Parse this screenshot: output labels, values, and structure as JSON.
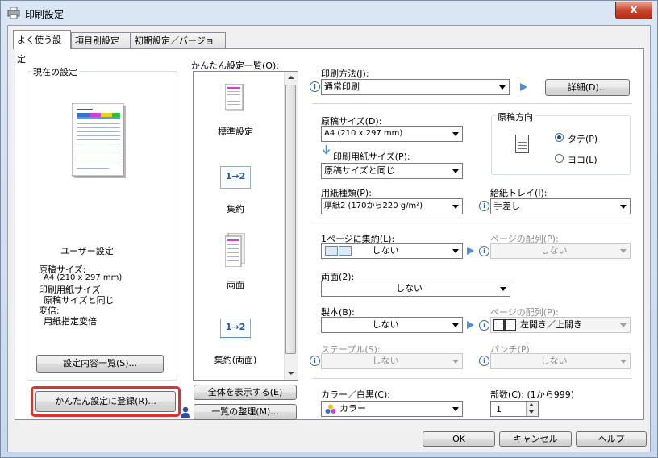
{
  "window": {
    "title": "印刷設定",
    "close_glyph": "x"
  },
  "tabs": [
    "よく使う設定",
    "項目別設定",
    "初期設定／バージョン"
  ],
  "current_settings": {
    "group_label": "現在の設定",
    "profile_name": "ユーザー設定",
    "original_size_label": "原稿サイズ:",
    "original_size_value": "A4 (210 x 297 mm)",
    "paper_size_label": "印刷用紙サイズ:",
    "paper_size_value": "原稿サイズと同じ",
    "scale_label": "変倍:",
    "scale_value": "用紙指定変倍",
    "list_button": "設定内容一覧(S)...",
    "register_button": "かんたん設定に登録(R)..."
  },
  "easy_list": {
    "label": "かんたん設定一覧(O):",
    "items": [
      "標準設定",
      "集約",
      "両面",
      "集約(両面)"
    ],
    "nup_glyph": "1→2",
    "show_all_button": "全体を表示する(E)",
    "organize_button": "一覧の整理(M)..."
  },
  "settings": {
    "print_method_label": "印刷方法(J):",
    "print_method_value": "通常印刷",
    "details_button": "詳細(D)...",
    "original_size_label": "原稿サイズ(D):",
    "original_size_value": "A4 (210 x 297 mm)",
    "paper_size_label": "印刷用紙サイズ(P):",
    "paper_size_value": "原稿サイズと同じ",
    "orientation_label": "原稿方向",
    "orientation_portrait": "タテ(P)",
    "orientation_landscape": "ヨコ(L)",
    "paper_type_label": "用紙種類(P):",
    "paper_type_value": "厚紙2 (170から220 g/m²)",
    "tray_label": "給紙トレイ(I):",
    "tray_value": "手差し",
    "nup_label": "1ページに集約(L):",
    "nup_value": "しない",
    "page_order_label": "ページの配列(P):",
    "page_order_value": "しない",
    "duplex_label": "両面(2):",
    "duplex_value": "しない",
    "booklet_label": "製本(B):",
    "booklet_value": "しない",
    "booklet_order_label": "ページの配列(P):",
    "booklet_order_value": "左開き／上開き",
    "staple_label": "ステープル(S):",
    "staple_value": "しない",
    "punch_label": "パンチ(P):",
    "punch_value": "しない",
    "color_label": "カラー／白黒(C):",
    "color_value": "カラー",
    "copies_label": "部数(C): (1から999)",
    "copies_value": "1"
  },
  "footer": {
    "ok": "OK",
    "cancel": "キャンセル",
    "help": "ヘルプ"
  },
  "colors": {
    "highlight_red": "#e0312e",
    "accent_blue": "#4f8fd8"
  }
}
